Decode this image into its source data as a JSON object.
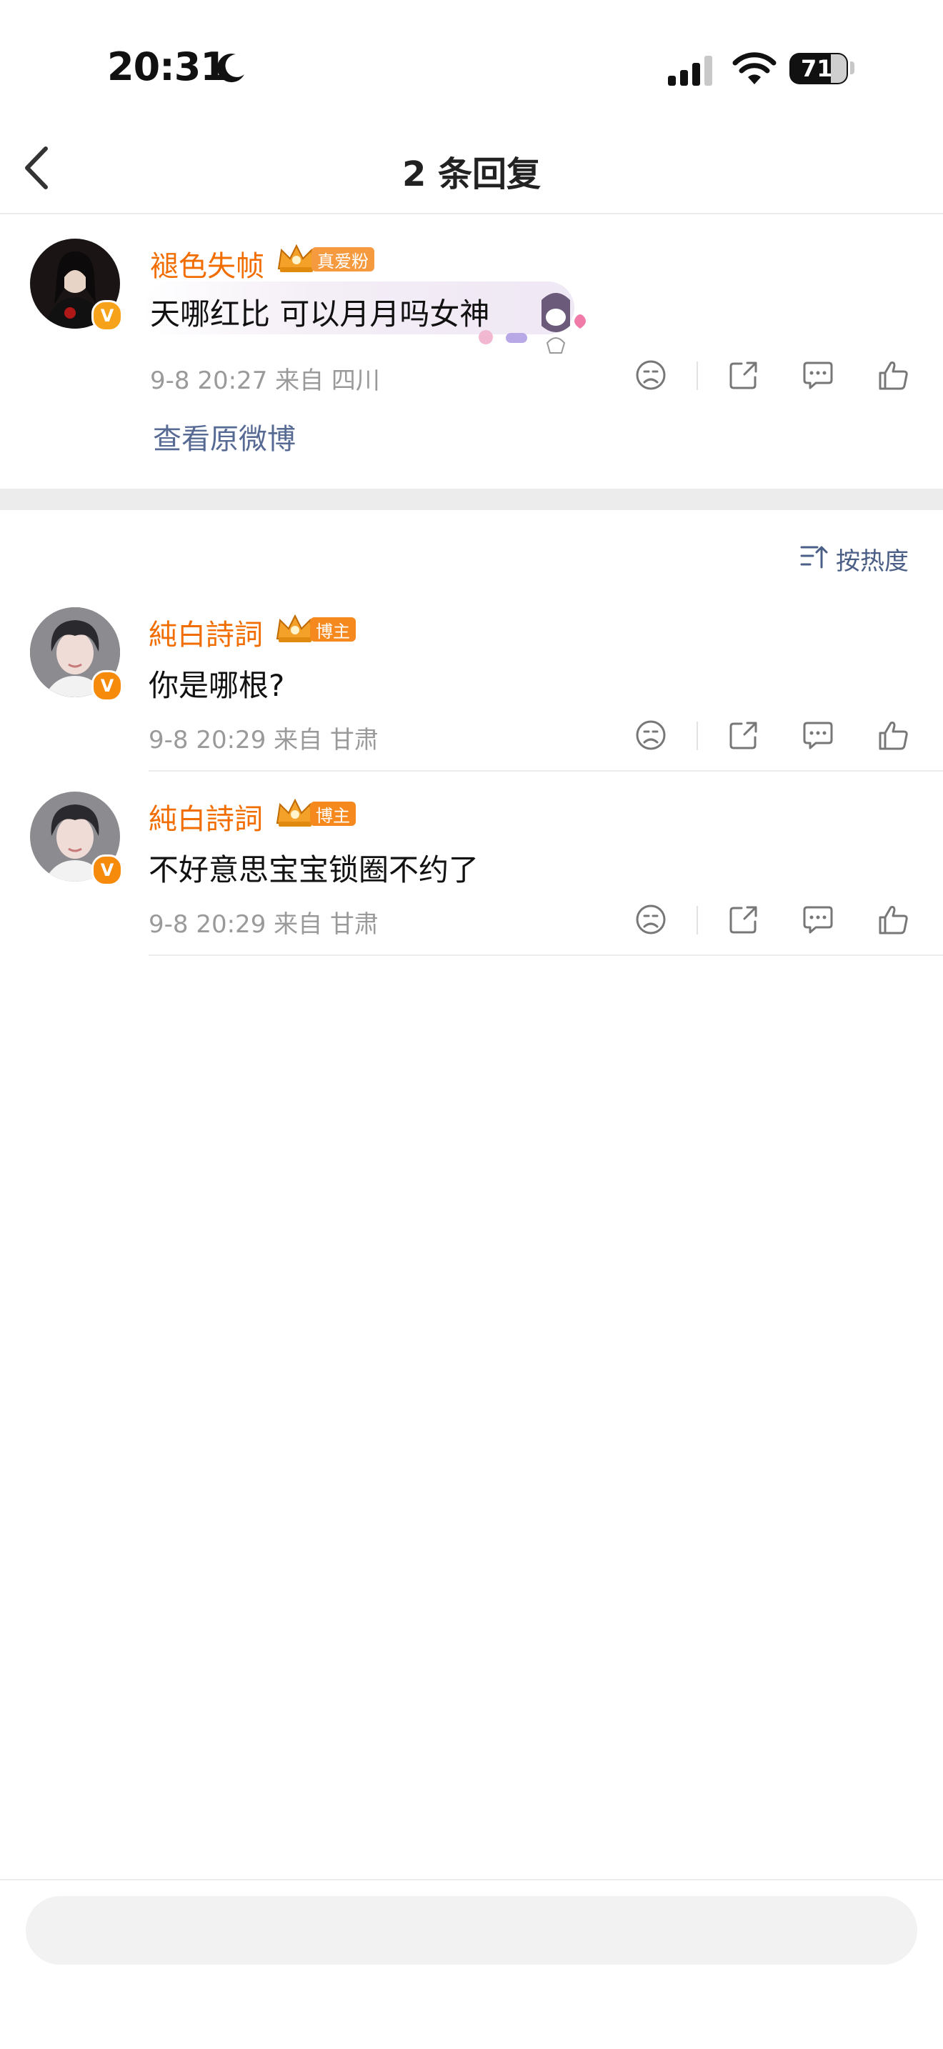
{
  "status_bar": {
    "time": "20:31",
    "battery": "71"
  },
  "header": {
    "title": "2 条回复"
  },
  "original_comment": {
    "username": "褪色失帧",
    "badge": "真爱粉",
    "text": "天哪红比 可以月月吗女神",
    "meta": "9-8 20:27  来自 四川",
    "view_original": "查看原微博"
  },
  "sort": {
    "label": "按热度"
  },
  "replies": [
    {
      "username": "純白詩詞",
      "badge": "博主",
      "text": "你是哪根?",
      "meta": "9-8 20:29  来自 甘肃"
    },
    {
      "username": "純白詩詞",
      "badge": "博主",
      "text": "不好意思宝宝锁圈不约了",
      "meta": "9-8 20:29  来自 甘肃"
    }
  ],
  "colors": {
    "username": "#f26d00",
    "link": "#566a94",
    "meta": "#9a9a9a",
    "badge_fan": "#f59a3e",
    "badge_blogger": "#f5891e"
  },
  "icons": [
    "back-icon",
    "dislike-icon",
    "share-icon",
    "comment-icon",
    "like-icon",
    "sort-icon",
    "verified-icon",
    "crown-icon",
    "moon-icon",
    "signal-icon",
    "wifi-icon",
    "battery-icon"
  ],
  "verified_mark": "V"
}
